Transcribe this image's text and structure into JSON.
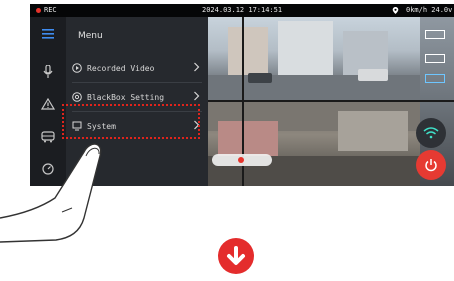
{
  "statusbar": {
    "rec_label": "REC",
    "datetime": "2024.03.12 17:14:51",
    "speed": "0km/h 24.0v"
  },
  "menu": {
    "title": "Menu",
    "items": [
      {
        "label": "Recorded Video",
        "icon": "play-circle-icon"
      },
      {
        "label": "BlackBox Setting",
        "icon": "gear-icon"
      },
      {
        "label": "System",
        "icon": "monitor-icon"
      }
    ]
  },
  "sidebar": {
    "icons": [
      "hamburger-menu-icon",
      "microphone-icon",
      "warning-icon",
      "bus-icon",
      "gauge-icon"
    ]
  },
  "colors": {
    "accent_red": "#e42c2c",
    "highlight_red": "#e0241c",
    "panel_bg": "#26292e"
  }
}
